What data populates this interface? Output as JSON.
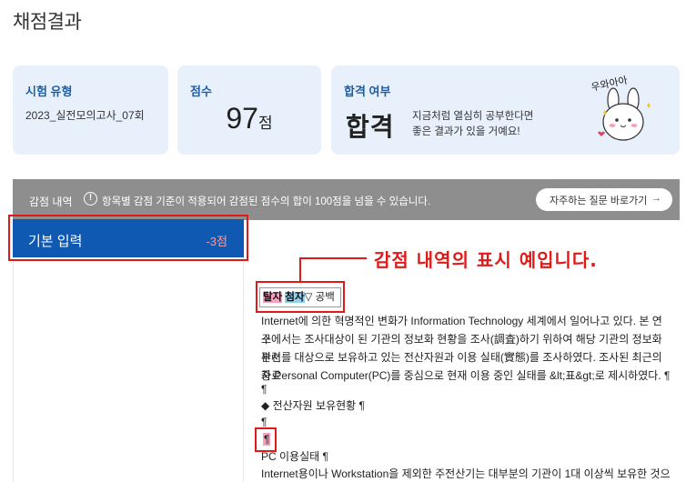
{
  "page": {
    "title": "채점결과"
  },
  "cards": {
    "exam_type": {
      "label": "시험 유형",
      "value": "2023_실전모의고사_07회"
    },
    "score": {
      "label": "점수",
      "value": "97",
      "unit": "점"
    },
    "pass": {
      "label": "합격 여부",
      "result": "합격",
      "message_line1": "지금처럼 열심히 공부한다면",
      "message_line2": "좋은 결과가 있을 거예요!",
      "sticker_text": "우와아아"
    }
  },
  "deductions": {
    "title": "감점 내역",
    "note": "항목별 감점 기준이 적용되어 감점된 점수의 합이 100점을 넘을 수 있습니다.",
    "faq_label": "자주하는 질문 바로가기",
    "categories": [
      {
        "name": "기본 입력",
        "points": "-3점"
      }
    ]
  },
  "annotation": {
    "text": "감점 내역의 표시 예입니다."
  },
  "legend": {
    "missing": "탈자",
    "extra": "첨자",
    "space_symbol": "▽",
    "space_label": "공백"
  },
  "document": {
    "lines": [
      "Internet에 의한 혁명적인 변화가 Information Technology 세계에서 일어나고 있다. 본 연구",
      "소에서는 조사대상이 된 기관의 정보화 현황을 조사(調査)하기 위하여 해당 기관의 정보화 관련",
      "부서를 대상으로 보유하고 있는 전산자원과 이용 실태(實態)를 조사하였다. 조사된 최근의 자료",
      "중 Personal Computer(PC)를 중심으로 현재 이용 중인 실태를 &lt;표&gt;로 제시하였다. ¶",
      "¶",
      "◆ 전산자원 보유현황 ¶",
      "¶",
      "¶",
      "PC 이용실태 ¶",
      "Internet용이나 Workstation을 제외한 주전산기는 대부분의 기관이 1대 이상씩 보유한 것으로"
    ]
  },
  "colors": {
    "accent": "#1059b2",
    "annotation_red": "#e01919",
    "card_bg": "#e8f1fb",
    "bar_gray": "#8e8e8e"
  }
}
